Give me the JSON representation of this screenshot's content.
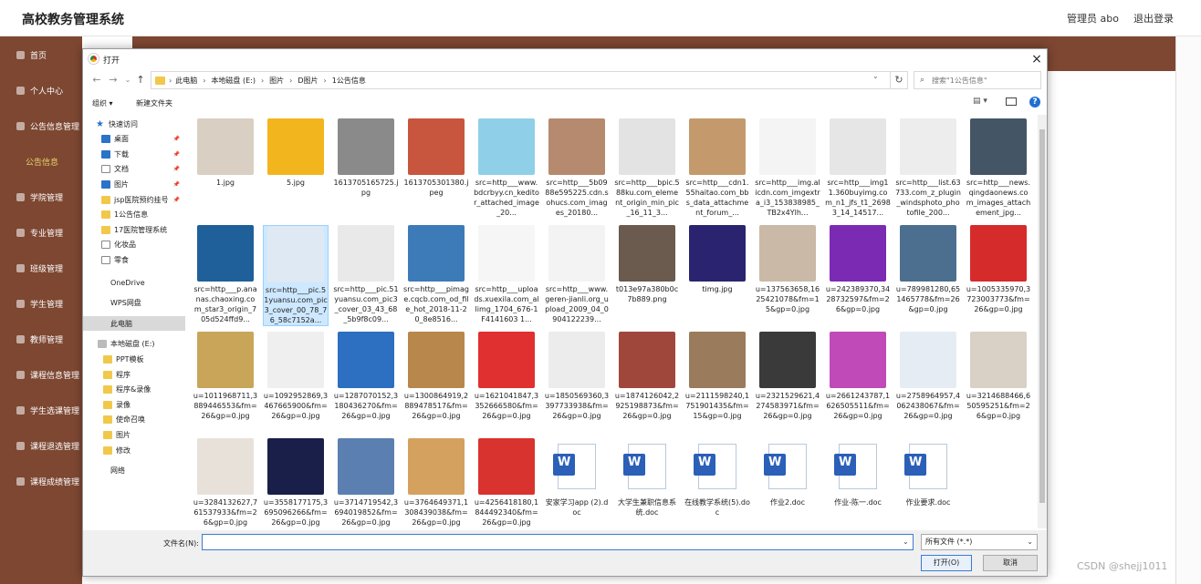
{
  "app": {
    "title": "高校教务管理系统",
    "user_label": "管理员 abo",
    "logout": "退出登录"
  },
  "sidebar": {
    "items": [
      {
        "label": "首页"
      },
      {
        "label": "个人中心"
      },
      {
        "label": "公告信息管理"
      },
      {
        "label": "公告信息",
        "active": true
      },
      {
        "label": "学院管理"
      },
      {
        "label": "专业管理"
      },
      {
        "label": "班级管理"
      },
      {
        "label": "学生管理"
      },
      {
        "label": "教师管理"
      },
      {
        "label": "课程信息管理"
      },
      {
        "label": "学生选课管理"
      },
      {
        "label": "课程退选管理"
      },
      {
        "label": "课程成绩管理"
      }
    ]
  },
  "dialog": {
    "title": "打开",
    "close": "×",
    "breadcrumb": [
      "此电脑",
      "本地磁盘 (E:)",
      "图片",
      "D图片",
      "1公告信息"
    ],
    "search_placeholder": "搜索\"1公告信息\"",
    "toolbar": {
      "organize": "组织 ▾",
      "new_folder": "新建文件夹"
    },
    "nav": [
      {
        "label": "快速访问",
        "icon": "star",
        "indent": 14
      },
      {
        "label": "桌面",
        "icon": "blue",
        "indent": 20,
        "pin": true
      },
      {
        "label": "下载",
        "icon": "blue",
        "indent": 20,
        "pin": true
      },
      {
        "label": "文档",
        "icon": "doc",
        "indent": 20,
        "pin": true
      },
      {
        "label": "图片",
        "icon": "blue",
        "indent": 20,
        "pin": true
      },
      {
        "label": "jsp医院预约挂号",
        "icon": "folder",
        "indent": 20,
        "pin": true
      },
      {
        "label": "1公告信息",
        "icon": "folder",
        "indent": 20
      },
      {
        "label": "17医院管理系统",
        "icon": "folder",
        "indent": 20
      },
      {
        "label": "化妆品",
        "icon": "doc",
        "indent": 20
      },
      {
        "label": "零食",
        "icon": "doc",
        "indent": 20
      },
      {
        "label": "OneDrive",
        "icon": "none",
        "indent": 30,
        "gap": 8
      },
      {
        "label": "WPS网盘",
        "icon": "none",
        "indent": 30,
        "gap": 6
      },
      {
        "label": "此电脑",
        "icon": "none",
        "indent": 30,
        "gap": 6,
        "selected": true
      },
      {
        "label": "本地磁盘 (E:)",
        "icon": "drive",
        "indent": 16,
        "gap": 6
      },
      {
        "label": "PPT模板",
        "icon": "folder",
        "indent": 22
      },
      {
        "label": "程序",
        "icon": "folder",
        "indent": 22
      },
      {
        "label": "程序&录像",
        "icon": "folder",
        "indent": 22
      },
      {
        "label": "录像",
        "icon": "folder",
        "indent": 22
      },
      {
        "label": "使命召唤",
        "icon": "folder",
        "indent": 22
      },
      {
        "label": "图片",
        "icon": "folder",
        "indent": 22
      },
      {
        "label": "修改",
        "icon": "folder",
        "indent": 22
      },
      {
        "label": "网络",
        "icon": "none",
        "indent": 30,
        "gap": 6
      }
    ],
    "files": [
      {
        "name": "1.jpg",
        "color": "#d9cfc3"
      },
      {
        "name": "5.jpg",
        "color": "#f2b51d"
      },
      {
        "name": "1613705165725.jpg",
        "color": "#8a8a8a"
      },
      {
        "name": "1613705301380.jpeg",
        "color": "#c8553d"
      },
      {
        "name": "src=http___www.bdcrbyy.cn_keditor_attached_image_20...",
        "color": "#8fd0e8"
      },
      {
        "name": "src=http___5b0988e595225.cdn.sohucs.com_images_20180...",
        "color": "#b58a6e"
      },
      {
        "name": "src=http___bpic.588ku.com_element_origin_min_pic_16_11_3...",
        "color": "#e3e3e3"
      },
      {
        "name": "src=http___cdn1.55haitao.com_bbs_data_attachment_forum_...",
        "color": "#c49a6c"
      },
      {
        "name": "src=http___img.alicdn.com_imgextra_i3_153838985_TB2x4Ylh...",
        "color": "#f4f4f4"
      },
      {
        "name": "src=http___img11.360buyimg.com_n1_jfs_t1_26983_14_14517...",
        "color": "#e6e6e6"
      },
      {
        "name": "src=http___list.63733.com_z_plugin_windsphoto_photofile_200...",
        "color": "#ededed"
      },
      {
        "name": "src=http___news.qingdaonews.com_images_attachement_jpg...",
        "color": "#445566"
      },
      {
        "name": "src=http___p.ananas.chaoxing.com_star3_origin_705d524ffd9...",
        "color": "#1f5f9a"
      },
      {
        "name": "src=http___pic.51yuansu.com_pic3_cover_00_78_76_58c7152a...",
        "color": "#dfe9f3",
        "selected": true
      },
      {
        "name": "src=http___pic.51yuansu.com_pic3_cover_03_43_68_5b9f8c09...",
        "color": "#e9e9e9"
      },
      {
        "name": "src=http___pimage.cqcb.com_od_file_hot_2018-11-20_8e8516...",
        "color": "#3d7bb8"
      },
      {
        "name": "src=http___uploads.xuexila.com_allimg_1704_676-1F4141603 1...",
        "color": "#f6f6f6"
      },
      {
        "name": "src=http___www.geren-jianli.org_upload_2009_04_0904122239...",
        "color": "#f3f3f3"
      },
      {
        "name": "t013e97a380b0c7b889.png",
        "color": "#6b5a4e"
      },
      {
        "name": "timg.jpg",
        "color": "#2a2470"
      },
      {
        "name": "u=137563658,1625421078&fm=15&gp=0.jpg",
        "color": "#c9b9a6"
      },
      {
        "name": "u=242389370,3428732597&fm=26&gp=0.jpg",
        "color": "#7b2bb3"
      },
      {
        "name": "u=789981280,651465778&fm=26&gp=0.jpg",
        "color": "#4d6f8f"
      },
      {
        "name": "u=1005335970,3723003773&fm=26&gp=0.jpg",
        "color": "#d62b2b"
      },
      {
        "name": "u=1011968711,3889446553&fm=26&gp=0.jpg",
        "color": "#c9a55a"
      },
      {
        "name": "u=1092952869,3467665900&fm=26&gp=0.jpg",
        "color": "#efefef"
      },
      {
        "name": "u=1287070152,3180436270&fm=26&gp=0.jpg",
        "color": "#2d6fc0"
      },
      {
        "name": "u=1300864919,2889478517&fm=26&gp=0.jpg",
        "color": "#b8874c"
      },
      {
        "name": "u=1621041847,3352666580&fm=26&gp=0.jpg",
        "color": "#e03030"
      },
      {
        "name": "u=1850569360,3397733938&fm=26&gp=0.jpg",
        "color": "#ececec"
      },
      {
        "name": "u=1874126042,2925198873&fm=26&gp=0.jpg",
        "color": "#a0473c"
      },
      {
        "name": "u=2111598240,1751901435&fm=15&gp=0.jpg",
        "color": "#9a7b5c"
      },
      {
        "name": "u=2321529621,4274583971&fm=26&gp=0.jpg",
        "color": "#3a3a3a"
      },
      {
        "name": "u=2661243787,1626505511&fm=26&gp=0.jpg",
        "color": "#c04ab8"
      },
      {
        "name": "u=2758964957,4062438067&fm=26&gp=0.jpg",
        "color": "#e6ecf4"
      },
      {
        "name": "u=3214688466,650595251&fm=26&gp=0.jpg",
        "color": "#d9d0c6"
      },
      {
        "name": "u=3284132627,761537933&fm=26&gp=0.jpg",
        "color": "#e7e1da"
      },
      {
        "name": "u=3558177175,3695096266&fm=26&gp=0.jpg",
        "color": "#1a1f4a"
      },
      {
        "name": "u=3714719542,3694019852&fm=26&gp=0.jpg",
        "color": "#5b7fb0"
      },
      {
        "name": "u=3764649371,1308439038&fm=26&gp=0.jpg",
        "color": "#d4a15f"
      },
      {
        "name": "u=4256418180,1844492340&fm=26&gp=0.jpg",
        "color": "#d8332f"
      },
      {
        "name": "安家学习app (2).doc",
        "doc": true
      },
      {
        "name": "大学生兼职信息系统.doc",
        "doc": true
      },
      {
        "name": "在线教学系统(5).doc",
        "doc": true
      },
      {
        "name": "作业2.doc",
        "doc": true
      },
      {
        "name": "作业-陈一.doc",
        "doc": true
      },
      {
        "name": "作业要求.doc",
        "doc": true
      }
    ],
    "filename_label": "文件名(N):",
    "filename_value": "",
    "filetype": "所有文件 (*.*)",
    "open_button": "打开(O)",
    "cancel_button": "取消"
  },
  "watermark": "CSDN @shejj1011"
}
